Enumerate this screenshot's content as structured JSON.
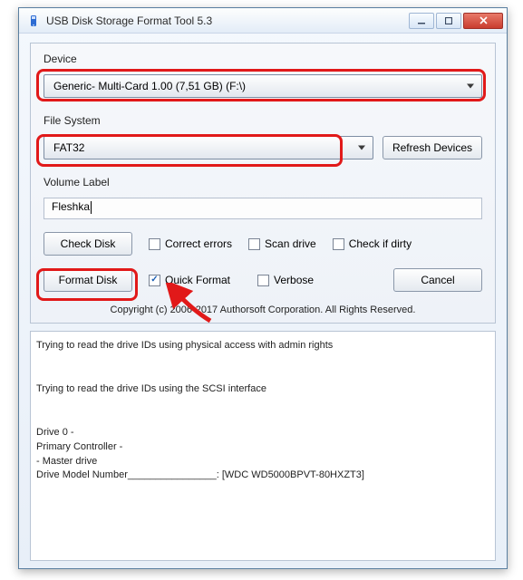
{
  "app": {
    "title": "USB Disk Storage Format Tool 5.3"
  },
  "device": {
    "label": "Device",
    "value": "Generic-  Multi-Card  1.00 (7,51 GB) (F:\\)"
  },
  "filesystem": {
    "label": "File System",
    "value": "FAT32",
    "refresh_btn": "Refresh Devices"
  },
  "volume": {
    "label": "Volume Label",
    "value": "Fleshka"
  },
  "buttons": {
    "check_disk": "Check Disk",
    "format_disk": "Format Disk",
    "cancel": "Cancel"
  },
  "checks": {
    "correct_errors": {
      "label": "Correct errors",
      "checked": false
    },
    "scan_drive": {
      "label": "Scan drive",
      "checked": false
    },
    "check_if_dirty": {
      "label": "Check if dirty",
      "checked": false
    },
    "quick_format": {
      "label": "Quick Format",
      "checked": true
    },
    "verbose": {
      "label": "Verbose",
      "checked": false
    }
  },
  "copyright": "Copyright (c) 2006-2017 Authorsoft Corporation. All Rights Reserved.",
  "log": "Trying to read the drive IDs using physical access with admin rights\n\n\nTrying to read the drive IDs using the SCSI interface\n\n\nDrive 0 -\nPrimary Controller -\n  - Master drive\nDrive Model Number________________: [WDC WD5000BPVT-80HXZT3]"
}
